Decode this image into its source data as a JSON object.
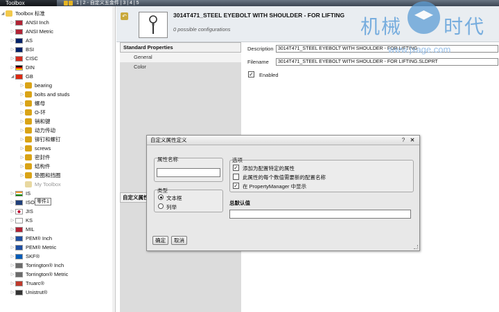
{
  "topbar": {
    "title": "Toolbox",
    "pages": "1 | 2 - 自定义五金件 | 3 | 4 | 5"
  },
  "tree": {
    "root": "Toolbox 标准",
    "items": [
      {
        "label": "ANSI Inch",
        "icon": "flag-usa-icon"
      },
      {
        "label": "ANSI Metric",
        "icon": "flag-usa-icon"
      },
      {
        "label": "AS",
        "icon": "flag-australia-icon"
      },
      {
        "label": "BSI",
        "icon": "flag-uk-icon"
      },
      {
        "label": "CISC",
        "icon": "flag-canada-icon"
      },
      {
        "label": "DIN",
        "icon": "flag-germany-icon"
      },
      {
        "label": "GB",
        "icon": "flag-china-icon"
      },
      {
        "label": "bearing",
        "icon": "gear-icon"
      },
      {
        "label": "bolts and studs",
        "icon": "bolts-icon"
      },
      {
        "label": "螺母",
        "icon": "nut-icon"
      },
      {
        "label": "O-环",
        "icon": "o-ring-icon"
      },
      {
        "label": "销和键",
        "icon": "pin-icon"
      },
      {
        "label": "动力传动",
        "icon": "gear-icon"
      },
      {
        "label": "铆钉和螺钉",
        "icon": "rivet-icon"
      },
      {
        "label": "screws",
        "icon": "screw-icon"
      },
      {
        "label": "密封件",
        "icon": "seal-icon"
      },
      {
        "label": "结构件",
        "icon": "structure-icon"
      },
      {
        "label": "垫圈和挡圈",
        "icon": "washer-icon"
      },
      {
        "label": "My Toolbox",
        "icon": "folder-icon"
      },
      {
        "label": "IS",
        "icon": "flag-india-icon"
      },
      {
        "label": "ISO",
        "icon": "iso-icon"
      },
      {
        "label": "JIS",
        "icon": "flag-japan-icon"
      },
      {
        "label": "KS",
        "icon": "flag-korea-icon"
      },
      {
        "label": "MIL",
        "icon": "flag-usa-icon"
      },
      {
        "label": "PEM® Inch",
        "icon": "pem-icon"
      },
      {
        "label": "PEM® Metric",
        "icon": "pem-icon"
      },
      {
        "label": "SKF®",
        "icon": "skf-icon"
      },
      {
        "label": "Torrington® Inch",
        "icon": "torrington-icon"
      },
      {
        "label": "Torrington® Metric",
        "icon": "torrington-icon"
      },
      {
        "label": "Truarc®",
        "icon": "truarc-icon"
      },
      {
        "label": "Unistrut®",
        "icon": "unistrut-icon"
      }
    ],
    "drag_tag": "零件1"
  },
  "part": {
    "title": "3014T471_STEEL EYEBOLT WITH SHOULDER - FOR LIFTING",
    "subtitle": "0 possible configurations"
  },
  "props": {
    "header": "Standard Properties",
    "items": [
      "General",
      "Color"
    ],
    "sub_header": "自定义属性"
  },
  "fields": {
    "description_label": "Description",
    "description_value": "3014T471_STEEL EYEBOLT WITH SHOULDER - FOR LIFTING",
    "filename_label": "Filename",
    "filename_value": "3014T471_STEEL EYEBOLT WITH SHOULDER - FOR LIFTING.SLDPRT",
    "enabled_label": "Enabled"
  },
  "watermark": {
    "text1": "机械",
    "text2": "时代",
    "url": "www.jxage.com"
  },
  "dialog": {
    "title": "自定义属性定义",
    "help": "?",
    "close": "✕",
    "name_group": "属性名称",
    "type_group": "类型",
    "type_text": "文本框",
    "type_list": "列举",
    "options_group": "选项",
    "opt1": "添加为配置特定的属性",
    "opt2": "此属性的每个数值需要新的配置名称",
    "opt3": "在 PropertyManager 中显示",
    "default_label": "总默认值",
    "ok": "确定",
    "cancel": "取消"
  }
}
